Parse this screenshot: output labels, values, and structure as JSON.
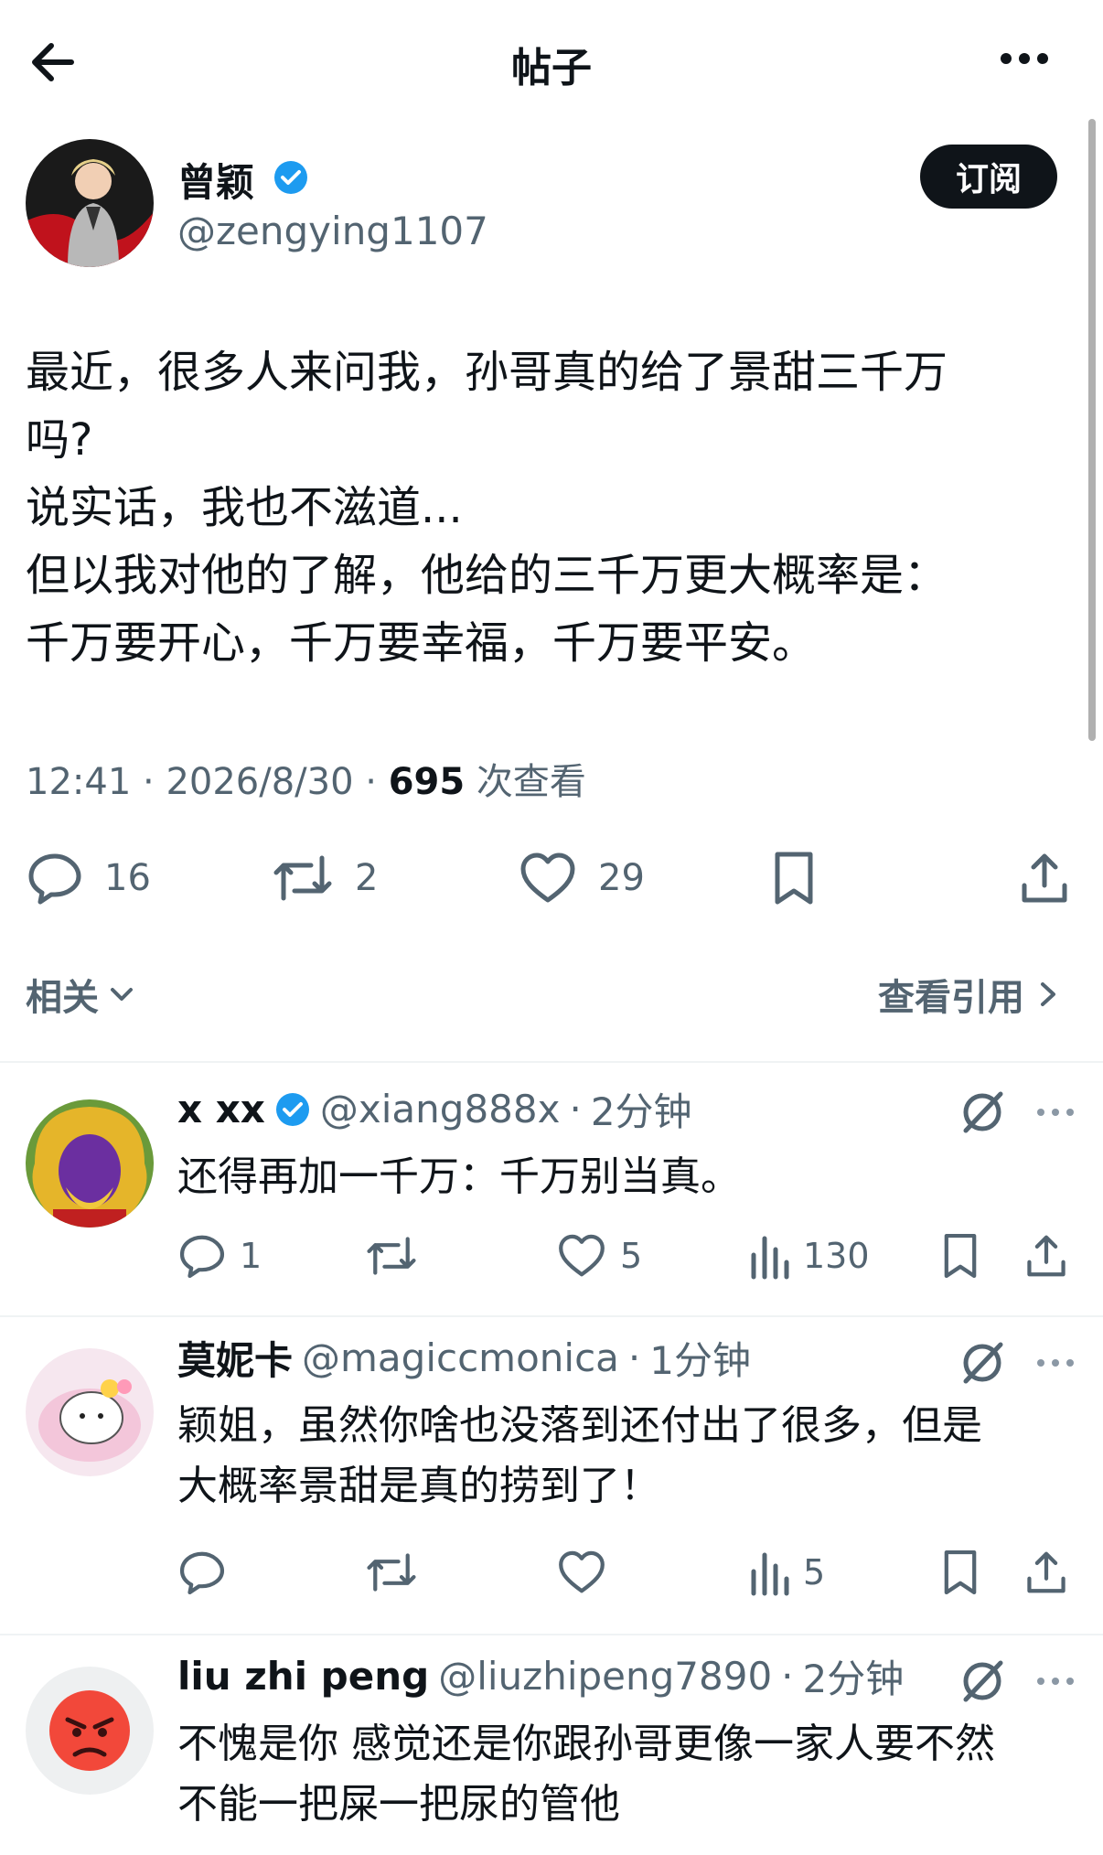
{
  "header": {
    "title": "帖子"
  },
  "post": {
    "author_name": "曾颖",
    "handle": "@zengying1107",
    "subscribe_label": "订阅",
    "text": "最近，很多人来问我，孙哥真的给了景甜三千万\n吗?\n说实话，我也不滋道...\n但以我对他的了解，他给的三千万更大概率是：\n千万要开心，千万要幸福，千万要平安。",
    "time": "12:41",
    "date": "2026/8/30",
    "views": "695",
    "views_label": "次查看",
    "replies": "16",
    "retweets": "2",
    "likes": "29"
  },
  "related_label": "相关",
  "quotes_label": "查看引用",
  "replies": [
    {
      "name": "x xx",
      "verified": true,
      "handle": "@xiang888x",
      "time": "2分钟",
      "text": "还得再加一千万：千万别当真。",
      "replies": "1",
      "retweets": "",
      "likes": "5",
      "views": "130"
    },
    {
      "name": "莫妮卡",
      "verified": false,
      "handle": "@magiccmonica",
      "time": "1分钟",
      "text": "颖姐，虽然你啥也没落到还付出了很多，但是\n大概率景甜是真的捞到了！",
      "replies": "",
      "retweets": "",
      "likes": "",
      "views": "5"
    },
    {
      "name": "liu zhi peng",
      "verified": false,
      "handle": "@liuzhipeng7890",
      "time": "2分钟",
      "text": "不愧是你 感觉还是你跟孙哥更像一家人要不然\n不能一把屎一把尿的管他"
    }
  ],
  "colors": {
    "accent": "#1d9bf0",
    "text": "#0f1419",
    "secondary": "#536471",
    "divider": "#eff3f4"
  },
  "icons": [
    "back-arrow-icon",
    "more-icon",
    "verified-badge-icon",
    "reply-icon",
    "retweet-icon",
    "like-icon",
    "bookmark-icon",
    "share-icon",
    "chevron-down-icon",
    "chevron-right-icon",
    "grok-icon",
    "views-icon",
    "angry-emoji-icon"
  ]
}
